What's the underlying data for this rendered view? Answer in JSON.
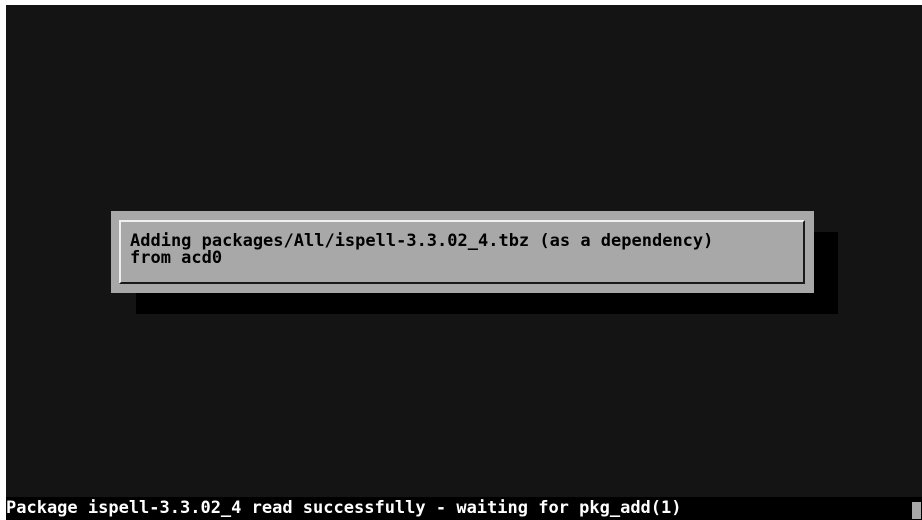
{
  "dialog": {
    "lines": [
      "Adding packages/All/ispell-3.3.02_4.tbz (as a dependency)",
      "from acd0"
    ]
  },
  "status": {
    "text": "Package ispell-3.3.02_4 read successfully - waiting for pkg_add(1)"
  },
  "colors": {
    "screen_background": "#141414",
    "dialog_background": "#a8a8a8",
    "dialog_text": "#000000",
    "status_text": "#ffffff"
  }
}
